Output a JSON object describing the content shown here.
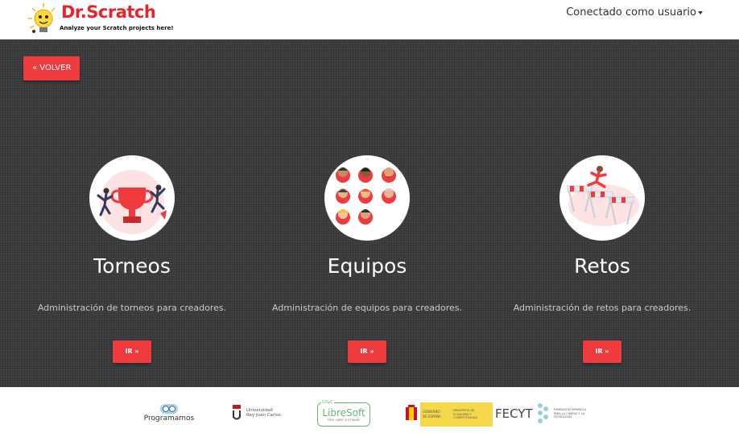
{
  "header": {
    "logo_text": "Dr.Scratch",
    "logo_tagline": "Analyze your Scratch projects here!",
    "user_menu_label": "Conectado como usuario"
  },
  "main": {
    "back_button": "« VOLVER",
    "cards": [
      {
        "title": "Torneos",
        "description": "Administración de torneos para creadores.",
        "button": "IR »"
      },
      {
        "title": "Equipos",
        "description": "Administración de equipos para creadores.",
        "button": "IR »"
      },
      {
        "title": "Retos",
        "description": "Administración de retos para creadores.",
        "button": "IR »"
      }
    ]
  },
  "footer": {
    "sponsors": [
      {
        "name": "Programamos",
        "sub": "Programamos"
      },
      {
        "name": "Universidad Rey Juan Carlos",
        "line1": "Universidad",
        "line2": "Rey Juan Carlos"
      },
      {
        "name": "LibreSoft",
        "top": "GSyC",
        "main": "LibreSoft",
        "sub": "FREE LIBRE SOFTWARE"
      },
      {
        "name": "Gobierno de España",
        "line1": "GOBIERNO",
        "line2": "DE ESPAÑA",
        "ministry": "MINISTERIO DE ECONOMÍA Y COMPETITIVIDAD"
      },
      {
        "name": "FECYT",
        "main": "FECYT",
        "sub": "FUNDACIÓN ESPAÑOLA PARA LA CIENCIA Y LA TECNOLOGÍA"
      }
    ]
  },
  "colors": {
    "accent": "#ef3b3d",
    "background": "#3a3b3d"
  },
  "icons": [
    "trophy-icon",
    "team-faces-icon",
    "hurdles-icon",
    "caret-down-icon"
  ]
}
